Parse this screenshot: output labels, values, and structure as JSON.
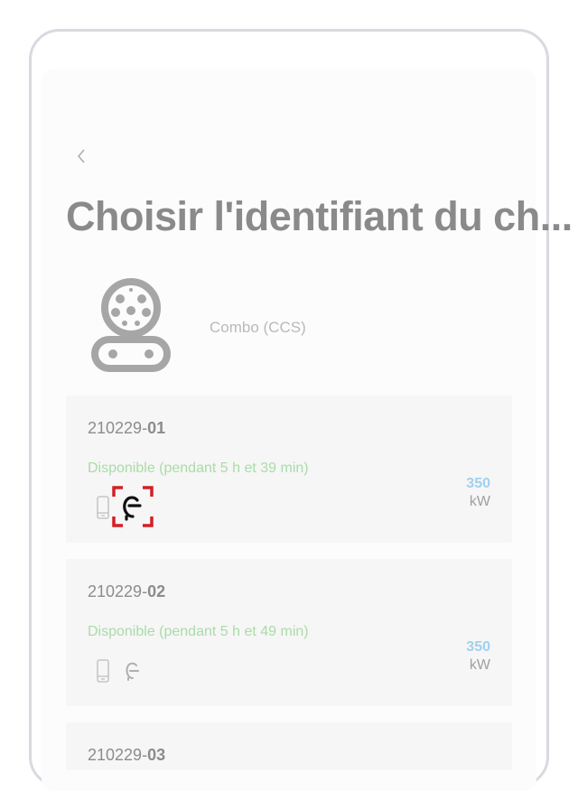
{
  "header": {
    "back_icon": "chevron-left-icon",
    "title": "Choisir l'identifiant du ch..."
  },
  "connector": {
    "icon": "ccs-combo-connector-icon",
    "name": "Combo (CCS)"
  },
  "chargers": [
    {
      "id_prefix": "210229-",
      "id_suffix": "01",
      "status": "Disponible (pendant 5 h et 39 min)",
      "power_value": "350",
      "power_unit": "kW",
      "highlighted": true
    },
    {
      "id_prefix": "210229-",
      "id_suffix": "02",
      "status": "Disponible (pendant 5 h et 49 min)",
      "power_value": "350",
      "power_unit": "kW",
      "highlighted": false
    },
    {
      "id_prefix": "210229-",
      "id_suffix": "03"
    }
  ],
  "colors": {
    "title": "#8a8a8a",
    "status_available": "#a9dca7",
    "power_value": "#9fd1ee",
    "highlight": "#d61f26",
    "card_background": "#f6f6f6"
  }
}
